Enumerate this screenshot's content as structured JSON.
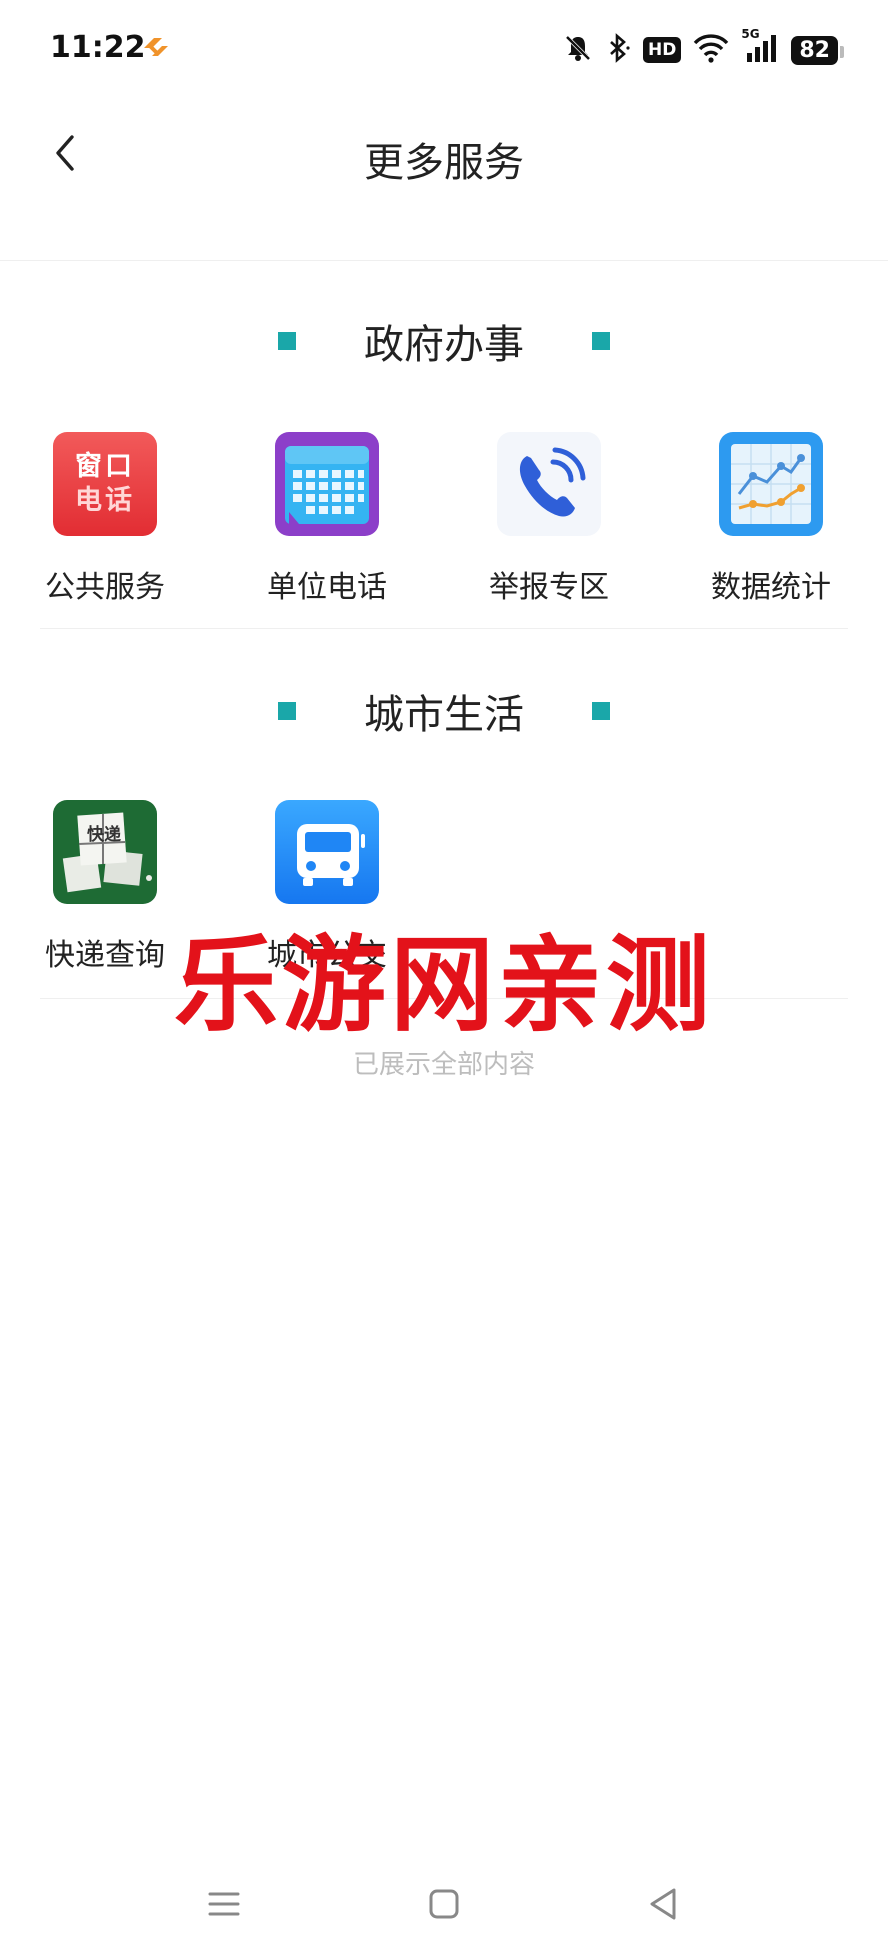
{
  "status_bar": {
    "time": "11:22",
    "hd_label": "HD",
    "network_label": "5G",
    "battery": "82"
  },
  "header": {
    "title": "更多服务"
  },
  "sections": [
    {
      "title": "政府办事",
      "items": [
        {
          "label": "公共服务",
          "icon": "window-phone-icon",
          "icon_text": [
            "窗口",
            "电话"
          ]
        },
        {
          "label": "单位电话",
          "icon": "calendar-icon"
        },
        {
          "label": "举报专区",
          "icon": "phone-call-icon"
        },
        {
          "label": "数据统计",
          "icon": "line-chart-icon"
        }
      ]
    },
    {
      "title": "城市生活",
      "items": [
        {
          "label": "快递查询",
          "icon": "parcel-icon",
          "icon_text": "快递"
        },
        {
          "label": "城市公交",
          "icon": "bus-icon"
        }
      ]
    }
  ],
  "end_text": "已展示全部内容",
  "watermark": "乐游网亲测",
  "colors": {
    "accent": "#1aa7a9",
    "watermark": "#e3121a"
  }
}
